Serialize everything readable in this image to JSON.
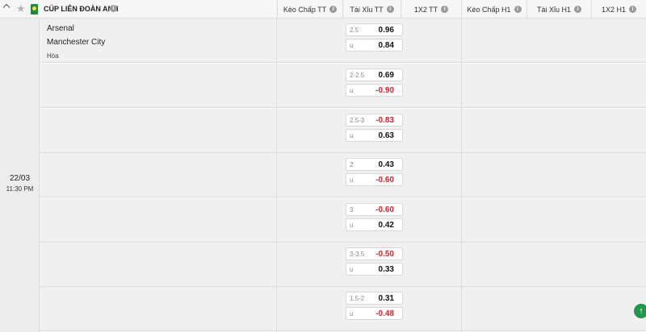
{
  "league": {
    "name": "CÚP LIÊN ĐOÀN ANH",
    "info_icon": "info-icon",
    "star_icon": "star-icon"
  },
  "columns": [
    {
      "label": "Kèo Chấp TT"
    },
    {
      "label": "Tài Xỉu TT"
    },
    {
      "label": "1X2 TT"
    },
    {
      "label": "Kèo Chấp H1"
    },
    {
      "label": "Tài Xỉu H1"
    },
    {
      "label": "1X2 H1"
    }
  ],
  "match": {
    "date": "22/03",
    "time": "11:30 PM",
    "home": "Arsenal",
    "away": "Manchester City",
    "draw": "Hòa"
  },
  "over_under_rows": [
    {
      "line": "2.5",
      "over": "0.96",
      "under_label": "u",
      "under": "0.84"
    },
    {
      "line": "2-2.5",
      "over": "0.69",
      "under_label": "u",
      "under": "-0.90"
    },
    {
      "line": "2.5-3",
      "over": "-0.83",
      "under_label": "u",
      "under": "0.63"
    },
    {
      "line": "2",
      "over": "0.43",
      "under_label": "u",
      "under": "-0.60"
    },
    {
      "line": "3",
      "over": "-0.60",
      "under_label": "u",
      "under": "0.42"
    },
    {
      "line": "3-3.5",
      "over": "-0.50",
      "under_label": "u",
      "under": "0.33"
    },
    {
      "line": "1.5-2",
      "over": "0.31",
      "under_label": "u",
      "under": "-0.48"
    }
  ],
  "colors": {
    "negative": "#d8232a",
    "accent": "#1e9a4a"
  },
  "scroll_top_icon": "arrow-up-icon"
}
